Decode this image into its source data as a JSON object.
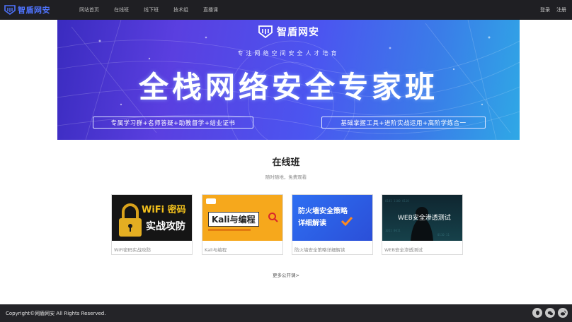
{
  "header": {
    "logo_text": "智盾网安",
    "nav": [
      "网站首页",
      "在线班",
      "线下班",
      "技术组",
      "直播课"
    ],
    "login": "登录",
    "register": "注册"
  },
  "banner": {
    "brand": "智盾网安",
    "subtitle": "专注网络空间安全人才培育",
    "title": "全栈网络安全专家班",
    "pill_left": "专属学习群+名师答疑+助教督学+结业证书",
    "pill_right": "基础掌握工具+进阶实战运用+高阶学练合一"
  },
  "section": {
    "title": "在线班",
    "desc": "随时随地，免费观看"
  },
  "courses": [
    {
      "thumb_line1": "WiFi 密码",
      "thumb_line2": "实战攻防",
      "caption": "WiFi密码实战攻防"
    },
    {
      "thumb_line1": "Kali与编程",
      "caption": "Kali与编程"
    },
    {
      "thumb_line1": "防火墙安全策略",
      "thumb_line2": "详细解读",
      "caption": "防火墙安全策略详细解读"
    },
    {
      "thumb_line1": "WEB安全渗透测试",
      "caption": "WEB安全渗透测试"
    }
  ],
  "more_link": "更多公开课>",
  "footer": {
    "copyright": "Copyright©网盾网安 All Rights Reserved."
  },
  "icons": [
    "logo-icon",
    "qq-icon",
    "wechat-icon",
    "weibo-icon",
    "search-icon",
    "lock-icon",
    "check-icon"
  ],
  "colors": {
    "topbar": "#1f1f23",
    "brand_blue": "#4f74ff",
    "footer": "#242428"
  }
}
